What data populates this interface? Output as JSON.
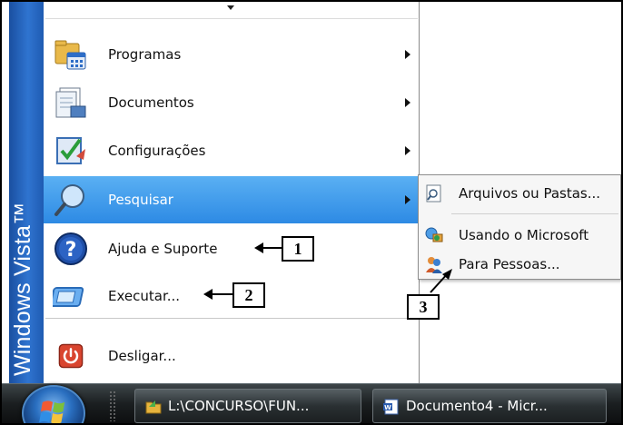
{
  "brand": {
    "text": "Windows Vista™"
  },
  "menu_items": [
    {
      "label": "Programas",
      "icon": "programs-folder-icon",
      "has_submenu": true
    },
    {
      "label": "Documentos",
      "icon": "documents-icon",
      "has_submenu": true
    },
    {
      "label": "Configurações",
      "icon": "settings-icon",
      "has_submenu": true
    },
    {
      "label": "Pesquisar",
      "icon": "search-magnifier-icon",
      "has_submenu": true,
      "selected": true
    },
    {
      "label": "Ajuda e Suporte",
      "icon": "help-icon",
      "has_submenu": false
    },
    {
      "label": "Executar...",
      "icon": "run-icon",
      "has_submenu": false
    },
    {
      "label": "Desligar...",
      "icon": "shutdown-icon",
      "has_submenu": false
    }
  ],
  "submenu_items": [
    {
      "label": "Arquivos ou Pastas...",
      "icon": "search-files-icon"
    },
    {
      "label": "Usando o Microsoft",
      "icon": "network-search-icon"
    },
    {
      "label": "Para Pessoas...",
      "icon": "people-search-icon"
    }
  ],
  "callouts": [
    {
      "number": "1"
    },
    {
      "number": "2"
    },
    {
      "number": "3"
    }
  ],
  "taskbar": {
    "buttons": [
      {
        "label": "L:\\CONCURSO\\FUN...",
        "icon": "folder-icon"
      },
      {
        "label": "Documento4 - Micr...",
        "icon": "word-document-icon"
      }
    ]
  },
  "colors": {
    "brand_strip": "#2f74d0",
    "selection": "#3b95ea",
    "taskbar": "#1b1f21"
  }
}
